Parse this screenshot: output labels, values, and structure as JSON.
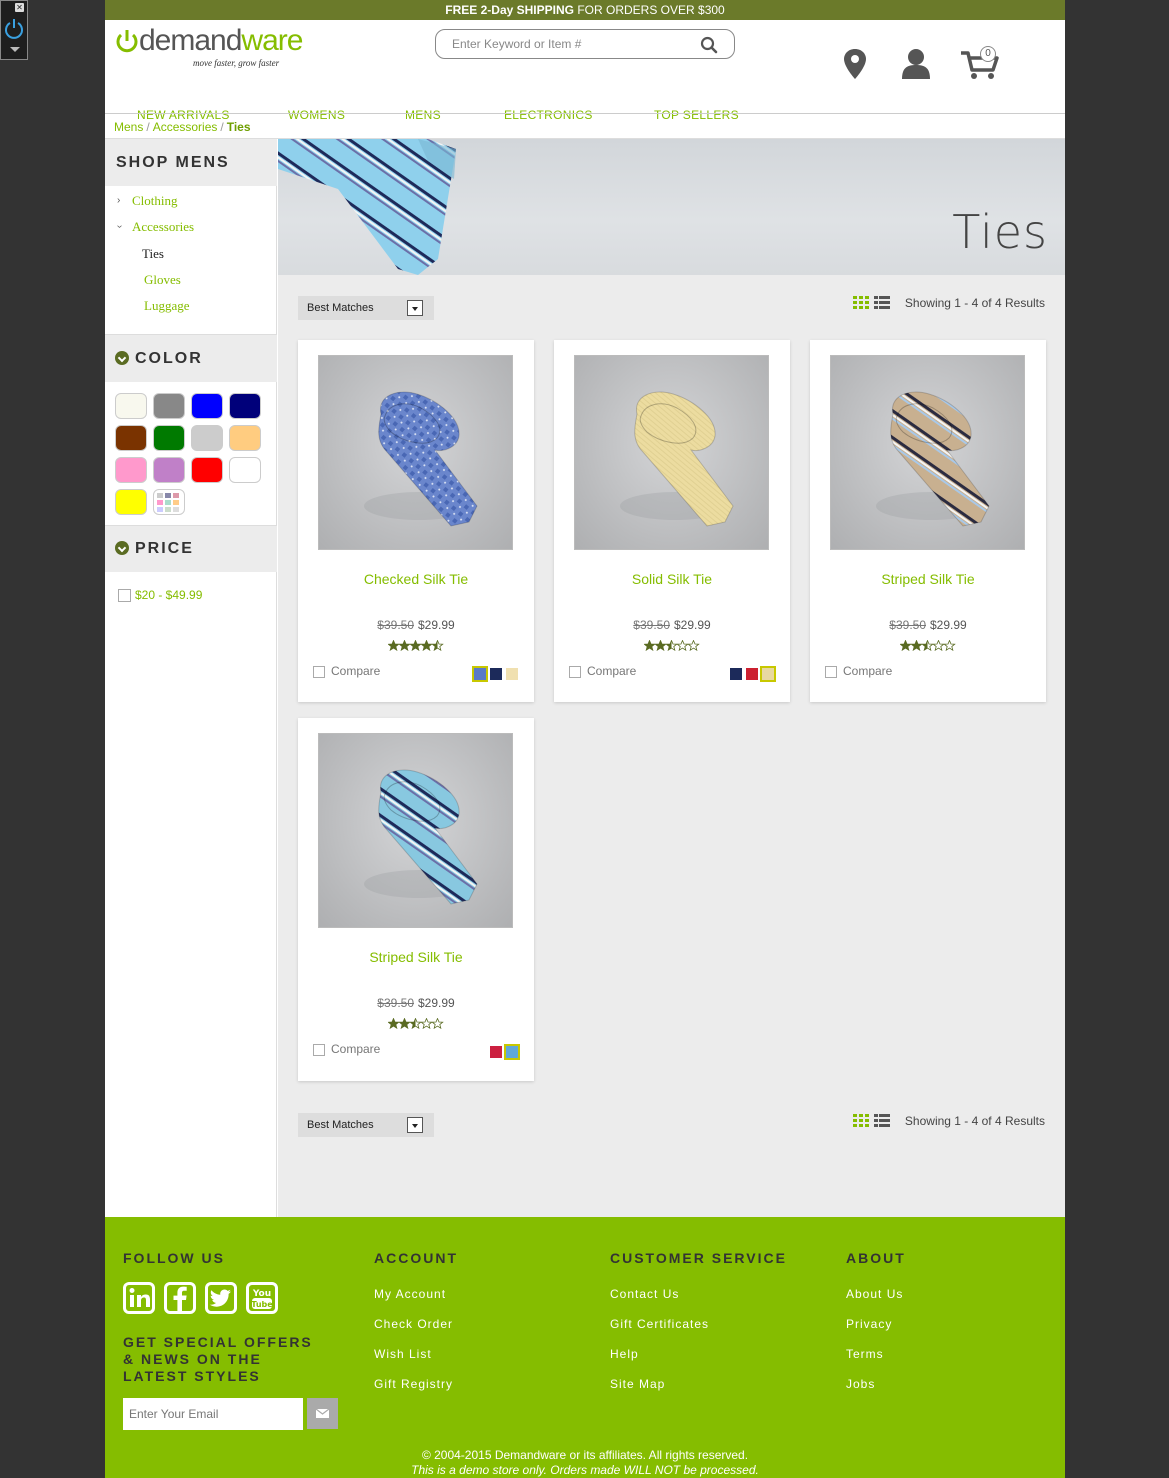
{
  "promo": {
    "bold": "FREE 2-Day",
    "bold2": "SHIPPING",
    "rest": "FOR ORDERS OVER $300"
  },
  "logo": {
    "name_a": "demand",
    "name_b": "ware",
    "tagline": "move faster, grow faster"
  },
  "search": {
    "placeholder": "Enter Keyword or Item #"
  },
  "cart": {
    "count": "0"
  },
  "nav": [
    "NEW ARRIVALS",
    "WOMENS",
    "MENS",
    "ELECTRONICS",
    "TOP SELLERS"
  ],
  "breadcrumb": [
    "Mens",
    "Accessories",
    "Ties"
  ],
  "sidebar": {
    "heading": "SHOP MENS",
    "categories": [
      "Clothing",
      "Accessories",
      "Ties",
      "Gloves",
      "Luggage"
    ],
    "color_heading": "COLOR",
    "colors": [
      "#f8f8ee",
      "#888888",
      "#0000ff",
      "#00007a",
      "#7a3300",
      "#007a00",
      "#cccccc",
      "#ffcc80",
      "#ff99cc",
      "#c080c8",
      "#ff0000",
      "#ffffff",
      "#ffff00",
      "miscellaneous"
    ],
    "price_heading": "PRICE",
    "price_option": "$20 - $49.99"
  },
  "banner": {
    "title": "Ties"
  },
  "sort": {
    "label": "Best Matches"
  },
  "results": {
    "text": "Showing 1 - 4 of 4 Results"
  },
  "products": [
    {
      "name": "Checked Silk Tie",
      "old_price": "$39.50",
      "price": "$29.99",
      "rating": 4.5,
      "compare": "Compare",
      "tie_color": "#6a86cc",
      "swatches": [
        "#5a7ac8",
        "#1c2a5a",
        "#f0e0b0"
      ],
      "selected": 0
    },
    {
      "name": "Solid Silk Tie",
      "old_price": "$39.50",
      "price": "$29.99",
      "rating": 2.5,
      "compare": "Compare",
      "tie_color": "#ecdca0",
      "swatches": [
        "#1c2a5a",
        "#cc2030",
        "#e8d8a0"
      ],
      "selected": 2
    },
    {
      "name": "Striped Silk Tie",
      "old_price": "$39.50",
      "price": "$29.99",
      "rating": 2.5,
      "compare": "Compare",
      "tie_color": "#c8b090",
      "swatches": [],
      "selected": -1
    },
    {
      "name": "Striped Silk Tie",
      "old_price": "$39.50",
      "price": "$29.99",
      "rating": 2.5,
      "compare": "Compare",
      "tie_color": "#88c8e0",
      "swatches": [
        "#cc2040",
        "#60a8d8"
      ],
      "selected": 1
    }
  ],
  "footer": {
    "follow_heading": "FOLLOW US",
    "social": [
      "linkedin-icon",
      "facebook-icon",
      "twitter-icon",
      "youtube-icon"
    ],
    "offers_heading": "GET SPECIAL OFFERS & NEWS ON THE LATEST STYLES",
    "email_placeholder": "Enter Your Email",
    "account_heading": "ACCOUNT",
    "account_links": [
      "My Account",
      "Check Order",
      "Wish List",
      "Gift Registry"
    ],
    "service_heading": "CUSTOMER SERVICE",
    "service_links": [
      "Contact Us",
      "Gift Certificates",
      "Help",
      "Site Map"
    ],
    "about_heading": "ABOUT",
    "about_links": [
      "About Us",
      "Privacy",
      "Terms",
      "Jobs"
    ],
    "copyright": "© 2004-2015 Demandware or its affiliates. All rights reserved.",
    "demo_note": "This is a demo store only. Orders made WILL NOT be processed."
  },
  "colors": {
    "accent": "#85bd00",
    "promo_bar": "#6b7a2a",
    "dark_accent": "#5a6b22"
  }
}
